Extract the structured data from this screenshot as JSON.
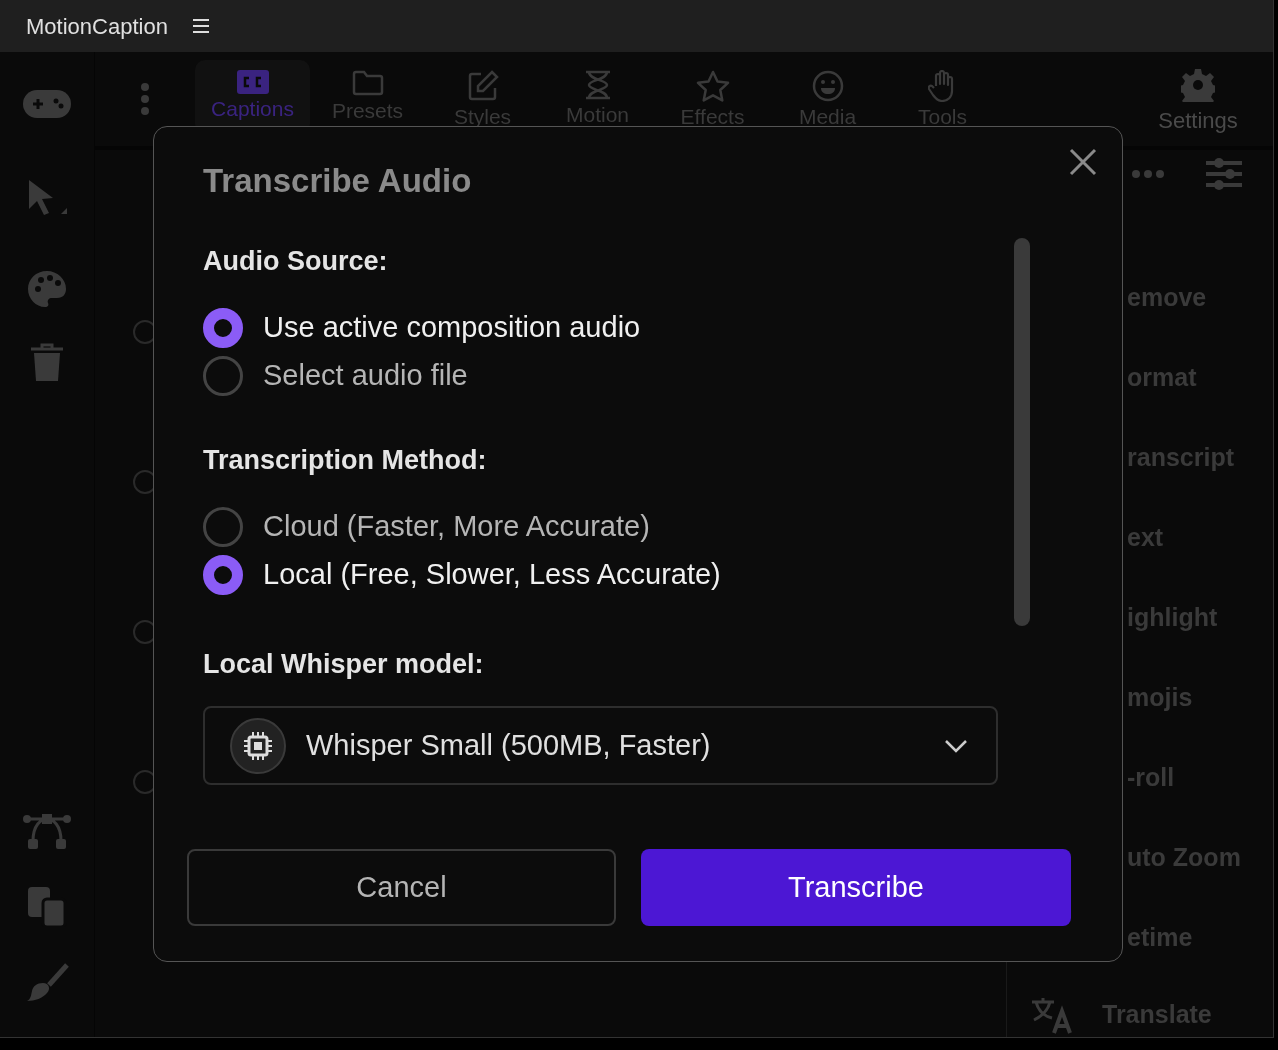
{
  "app": {
    "title": "MotionCaption"
  },
  "toolbar": {
    "tabs": [
      {
        "label": "Captions",
        "selected": true
      },
      {
        "label": "Presets",
        "selected": false
      },
      {
        "label": "Styles",
        "selected": false
      },
      {
        "label": "Motion",
        "selected": false
      },
      {
        "label": "Effects",
        "selected": false
      },
      {
        "label": "Media",
        "selected": false
      },
      {
        "label": "Tools",
        "selected": false
      }
    ],
    "settings": "Settings"
  },
  "right_panel": {
    "items": [
      "emove",
      "ormat",
      "ranscript",
      "ext",
      "ighlight",
      "mojis",
      "-roll",
      "uto Zoom",
      "etime"
    ],
    "translate": "Translate"
  },
  "background_list": {
    "items": [
      {
        "selected": false
      },
      {
        "selected": false
      },
      {
        "selected": false
      },
      {
        "selected": false
      }
    ]
  },
  "dialog": {
    "title": "Transcribe Audio",
    "sections": [
      {
        "label": "Audio Source:",
        "options": [
          {
            "label": "Use active composition audio",
            "selected": true
          },
          {
            "label": "Select audio file",
            "selected": false
          }
        ]
      },
      {
        "label": "Transcription Method:",
        "options": [
          {
            "label": "Cloud (Faster, More Accurate)",
            "selected": false
          },
          {
            "label": "Local (Free, Slower, Less Accurate)",
            "selected": true
          }
        ]
      }
    ],
    "model": {
      "label": "Local Whisper model:",
      "value": "Whisper Small (500MB, Faster)"
    },
    "buttons": {
      "cancel": "Cancel",
      "confirm": "Transcribe"
    }
  }
}
